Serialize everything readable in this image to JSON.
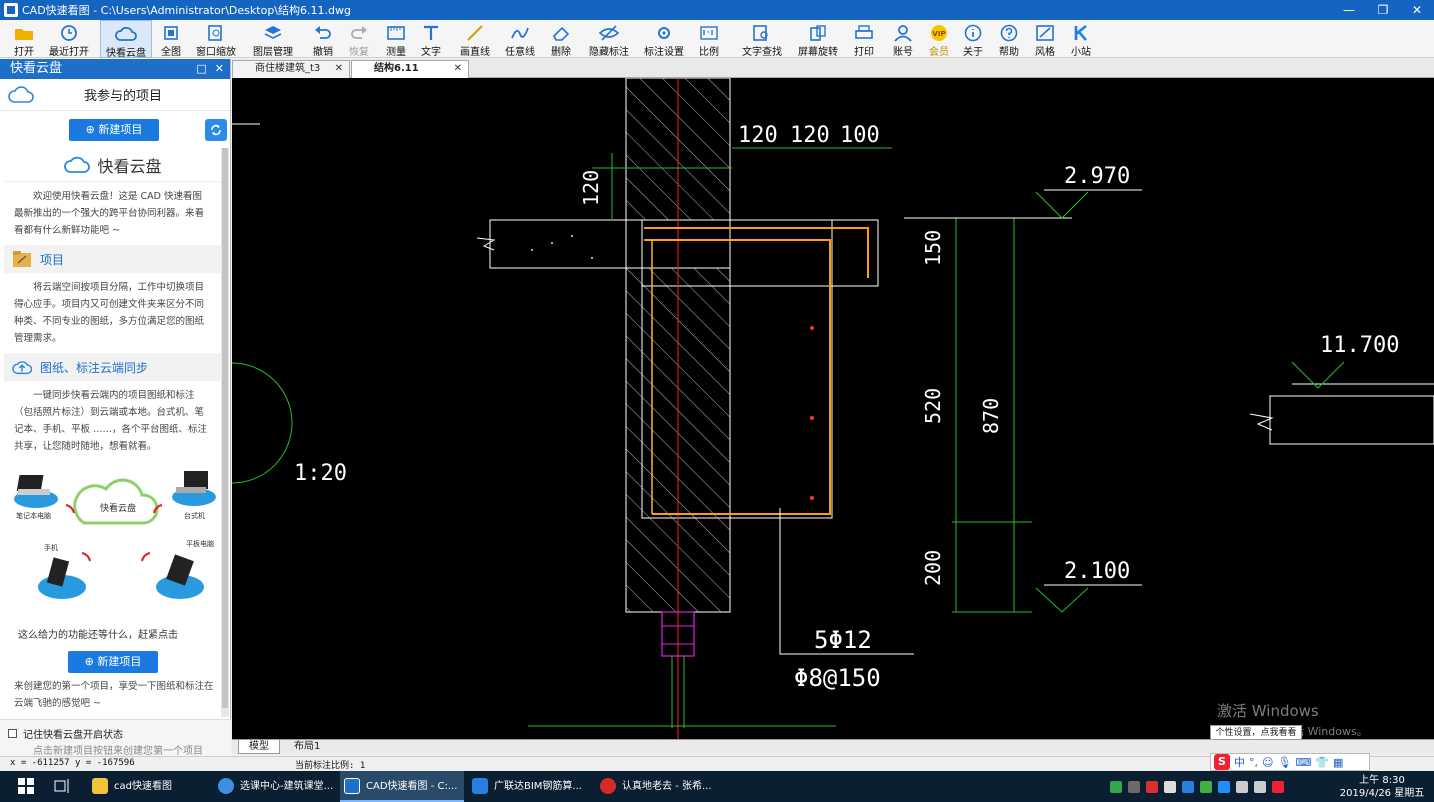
{
  "window": {
    "title": "CAD快速看图 - C:\\Users\\Administrator\\Desktop\\结构6.11.dwg",
    "controls": [
      "—",
      "❐",
      "✕"
    ]
  },
  "toolbar": {
    "items": [
      {
        "key": "open",
        "label": "打开",
        "icon": "folder-open-icon"
      },
      {
        "key": "recent",
        "label": "最近打开",
        "icon": "clock-icon"
      },
      {
        "key": "cloud",
        "label": "快看云盘",
        "icon": "cloud-icon",
        "active": true
      },
      {
        "key": "full",
        "label": "全图",
        "icon": "fit-all-icon"
      },
      {
        "key": "window-zoom",
        "label": "窗口缩放",
        "icon": "zoom-window-icon"
      },
      {
        "key": "layers",
        "label": "图层管理",
        "icon": "layers-icon"
      },
      {
        "key": "undo",
        "label": "撤销",
        "icon": "undo-icon"
      },
      {
        "key": "redo",
        "label": "恢复",
        "icon": "redo-icon",
        "disabled": true
      },
      {
        "key": "measure",
        "label": "测量",
        "icon": "measure-icon"
      },
      {
        "key": "text",
        "label": "文字",
        "icon": "text-icon"
      },
      {
        "key": "line",
        "label": "画直线",
        "icon": "line-icon"
      },
      {
        "key": "freehand",
        "label": "任意线",
        "icon": "freehand-icon"
      },
      {
        "key": "erase",
        "label": "删除",
        "icon": "eraser-icon"
      },
      {
        "key": "hide-marks",
        "label": "隐藏标注",
        "icon": "eye-hide-icon"
      },
      {
        "key": "mark-settings",
        "label": "标注设置",
        "icon": "mark-settings-icon"
      },
      {
        "key": "scale",
        "label": "比例",
        "icon": "scale-icon"
      },
      {
        "key": "text-search",
        "label": "文字查找",
        "icon": "text-search-icon"
      },
      {
        "key": "rotate",
        "label": "屏幕旋转",
        "icon": "rotate-screen-icon"
      },
      {
        "key": "print",
        "label": "打印",
        "icon": "print-icon"
      },
      {
        "key": "account",
        "label": "账号",
        "icon": "user-icon"
      },
      {
        "key": "vip",
        "label": "会员",
        "icon": "vip-icon",
        "vip": true
      },
      {
        "key": "about",
        "label": "关于",
        "icon": "info-icon"
      },
      {
        "key": "help",
        "label": "帮助",
        "icon": "help-icon"
      },
      {
        "key": "style",
        "label": "风格",
        "icon": "style-icon"
      },
      {
        "key": "site",
        "label": "小站",
        "icon": "k-logo-icon"
      }
    ]
  },
  "panel": {
    "title": "快看云盘",
    "header_buttons": [
      "□",
      "✕"
    ],
    "project_label": "我参与的项目",
    "new_project": "⊕ 新建项目",
    "cloud_title": "快看云盘",
    "intro": "欢迎使用快看云盘！这是 CAD 快速看图最新推出的一个强大的跨平台协同利器。来看看都有什么新鲜功能吧 ~",
    "section_project": "项目",
    "project_text": "将云端空间按项目分隔，工作中切换项目得心应手。项目内又可创建文件夹来区分不同种类、不同专业的图纸，多方位满足您的图纸管理需求。",
    "section_sync": "图纸、标注云端同步",
    "sync_text": "一键同步快看云端内的项目图纸和标注（包括照片标注）到云端或本地。台式机、笔记本、手机、平板 ……，各个平台图纸、标注共享，让您随时随地，想看就看。",
    "devices": {
      "laptop": "笔记本电脑",
      "cloud": "快看云盘",
      "desktop": "台式机",
      "phone": "手机",
      "tablet": "平板电脑"
    },
    "cta_text": "这么给力的功能还等什么，赶紧点击",
    "new_project_2": "⊕ 新建项目",
    "cta_text_2": "来创建您的第一个项目，享受一下图纸和标注在云端飞驰的感觉吧 ~",
    "remember": "记住快看云盘开启状态",
    "hint": "点击新建项目按钮来创建您第一个项目"
  },
  "tabs": [
    {
      "label": "商住楼建筑_t3",
      "close": "✕"
    },
    {
      "label": "结构6.11",
      "close": "✕",
      "active": true
    }
  ],
  "drawing": {
    "dims_top": [
      "120",
      "120",
      "100"
    ],
    "dim_vertical_top": "120",
    "elev_1": "2.970",
    "elev_2": "11.700",
    "elev_3": "2.100",
    "dims_right": [
      "150",
      "520",
      "200"
    ],
    "dim_total": "870",
    "scale_label": "1:20",
    "rebar_1": "5Φ12",
    "rebar_2": "Φ8@150",
    "colors": {
      "concrete_line": "#ffffff",
      "hatch": "#c8c8c8",
      "dim_green": "#22c02a",
      "dim_yellow": "#d6d600",
      "rebar": "#ff9f00",
      "axis_red": "#ff2020",
      "magenta": "#e020e0"
    }
  },
  "layout_tabs": [
    "模型",
    "布局1"
  ],
  "status": {
    "coords": "x = -611257 y = -167596",
    "scale": "当前标注比例: 1"
  },
  "watermark": {
    "line1": "激活 Windows",
    "line2": "转到\"设置\"以激活 Windows。"
  },
  "ime": {
    "tip": "个性设置，点我看看",
    "mode": "中"
  },
  "taskbar": {
    "tasks": [
      {
        "label": "cad快速看图",
        "icon": "folder-icon"
      },
      {
        "label": "选课中心-建筑课堂...",
        "icon": "browser-icon"
      },
      {
        "label": "CAD快速看图 - C:...",
        "icon": "cad-icon",
        "active": true
      },
      {
        "label": "广联达BIM钢筋算...",
        "icon": "glodon-icon"
      },
      {
        "label": "认真地老去 - 张希...",
        "icon": "music-icon"
      }
    ],
    "time": "上午 8:30",
    "date": "2019/4/26 星期五"
  }
}
